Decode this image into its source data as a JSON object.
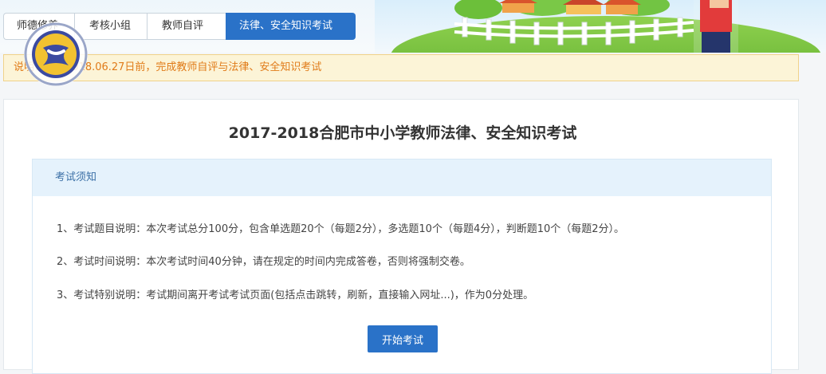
{
  "tabs": [
    {
      "label": "师德修养"
    },
    {
      "label": "考核小组"
    },
    {
      "label": "教师自评"
    },
    {
      "label": "法律、安全知识考试"
    }
  ],
  "active_tab": "法律、安全知识考试",
  "notice": {
    "text": "说明：请在2018.06.27日前，完成教师自评与法律、安全知识考试"
  },
  "exam": {
    "title": "2017-2018合肥市中小学教师法律、安全知识考试",
    "panel_title": "考试须知",
    "rules": [
      "1、考试题目说明：本次考试总分100分，包含单选题20个（每题2分），多选题10个（每题4分），判断题10个（每题2分）。",
      "2、考试时间说明：本次考试时间40分钟，请在规定的时间内完成答卷，否则将强制交卷。",
      "3、考试特别说明：考试期间离开考试考试页面(包括点击跳转，刷新，直接输入网址...)，作为0分处理。"
    ],
    "start_button": "开始考试"
  },
  "colors": {
    "primary": "#2a72c8",
    "notice_bg": "#fcf4d7",
    "notice_text": "#e07b19",
    "panel_head_bg": "#e5f2fc"
  },
  "icons": [
    "school-logo-icon",
    "banner-landscape-art"
  ]
}
